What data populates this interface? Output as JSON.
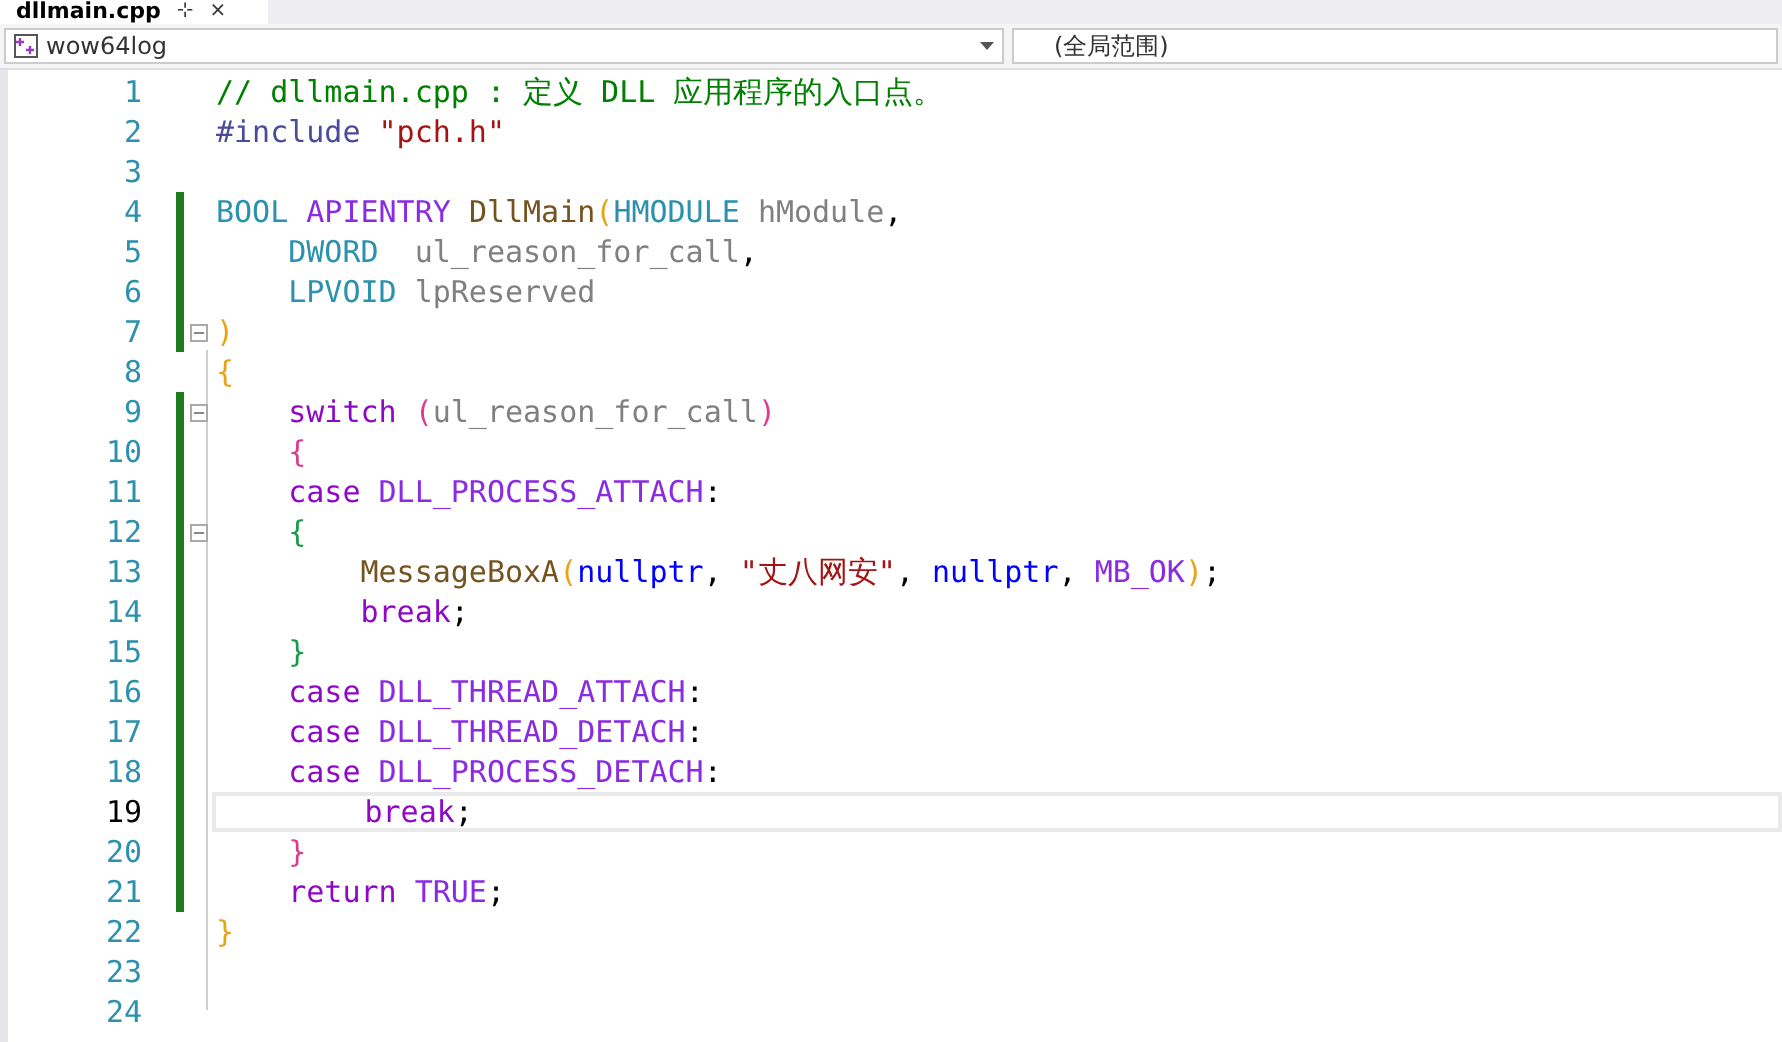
{
  "tab": {
    "title": "dllmain.cpp",
    "pin": "⊹",
    "close": "×"
  },
  "nav_bar": {
    "project": "wow64log",
    "scope": "(全局范围)"
  },
  "editor": {
    "lines": [
      {
        "number": "1",
        "current": false,
        "changed": false,
        "fold_box": false,
        "tokens": [
          {
            "kind": "comment",
            "text": "// dllmain.cpp : 定义 DLL 应用程序的入口点。"
          }
        ]
      },
      {
        "number": "2",
        "current": false,
        "changed": false,
        "fold_box": false,
        "tokens": [
          {
            "kind": "preproc",
            "text": "#include "
          },
          {
            "kind": "string",
            "text": "\"pch.h\""
          }
        ]
      },
      {
        "number": "3",
        "current": false,
        "changed": false,
        "fold_box": false
      },
      {
        "number": "4",
        "current": false,
        "changed": true,
        "fold_box": false,
        "tokens": [
          {
            "kind": "type",
            "text": "BOOL "
          },
          {
            "kind": "macro",
            "text": "APIENTRY "
          },
          {
            "kind": "func",
            "text": "DllMain"
          },
          {
            "kind": "brace1",
            "text": "("
          },
          {
            "kind": "type",
            "text": "HMODULE "
          },
          {
            "kind": "param",
            "text": "hModule"
          },
          {
            "kind": "plain",
            "text": ","
          }
        ]
      },
      {
        "number": "5",
        "current": false,
        "changed": true,
        "fold_box": false,
        "tokens": [
          {
            "kind": "type",
            "text": "    DWORD  "
          },
          {
            "kind": "param",
            "text": "ul_reason_for_call"
          },
          {
            "kind": "plain",
            "text": ","
          }
        ]
      },
      {
        "number": "6",
        "current": false,
        "changed": true,
        "fold_box": false,
        "tokens": [
          {
            "kind": "type",
            "text": "    LPVOID "
          },
          {
            "kind": "param",
            "text": "lpReserved"
          }
        ]
      },
      {
        "number": "7",
        "current": false,
        "changed": true,
        "fold_box": true,
        "tokens": [
          {
            "kind": "brace1",
            "text": ")"
          }
        ]
      },
      {
        "number": "8",
        "current": false,
        "changed": false,
        "fold_box": false,
        "tokens": [
          {
            "kind": "brace1",
            "text": "{"
          }
        ]
      },
      {
        "number": "9",
        "current": false,
        "changed": true,
        "fold_box": true,
        "tokens": [
          {
            "kind": "keyword",
            "text": "    switch "
          },
          {
            "kind": "brace2",
            "text": "("
          },
          {
            "kind": "param",
            "text": "ul_reason_for_call"
          },
          {
            "kind": "brace2",
            "text": ")"
          }
        ]
      },
      {
        "number": "10",
        "current": false,
        "changed": true,
        "fold_box": false,
        "tokens": [
          {
            "kind": "brace2",
            "text": "    {"
          }
        ]
      },
      {
        "number": "11",
        "current": false,
        "changed": true,
        "fold_box": false,
        "tokens": [
          {
            "kind": "keyword",
            "text": "    case "
          },
          {
            "kind": "macro",
            "text": "DLL_PROCESS_ATTACH"
          },
          {
            "kind": "plain",
            "text": ":"
          }
        ]
      },
      {
        "number": "12",
        "current": false,
        "changed": true,
        "fold_box": true,
        "tokens": [
          {
            "kind": "brace3",
            "text": "    {"
          }
        ]
      },
      {
        "number": "13",
        "current": false,
        "changed": true,
        "fold_box": false,
        "tokens": [
          {
            "kind": "func",
            "text": "        MessageBoxA"
          },
          {
            "kind": "brace1",
            "text": "("
          },
          {
            "kind": "constant",
            "text": "nullptr"
          },
          {
            "kind": "plain",
            "text": ", "
          },
          {
            "kind": "string",
            "text": "\"丈八网安\""
          },
          {
            "kind": "plain",
            "text": ", "
          },
          {
            "kind": "constant",
            "text": "nullptr"
          },
          {
            "kind": "plain",
            "text": ", "
          },
          {
            "kind": "macro",
            "text": "MB_OK"
          },
          {
            "kind": "brace1",
            "text": ")"
          },
          {
            "kind": "plain",
            "text": ";"
          }
        ]
      },
      {
        "number": "14",
        "current": false,
        "changed": true,
        "fold_box": false,
        "tokens": [
          {
            "kind": "keyword",
            "text": "        break"
          },
          {
            "kind": "plain",
            "text": ";"
          }
        ]
      },
      {
        "number": "15",
        "current": false,
        "changed": true,
        "fold_box": false,
        "tokens": [
          {
            "kind": "brace3",
            "text": "    }"
          }
        ]
      },
      {
        "number": "16",
        "current": false,
        "changed": true,
        "fold_box": false,
        "tokens": [
          {
            "kind": "keyword",
            "text": "    case "
          },
          {
            "kind": "macro",
            "text": "DLL_THREAD_ATTACH"
          },
          {
            "kind": "plain",
            "text": ":"
          }
        ]
      },
      {
        "number": "17",
        "current": false,
        "changed": true,
        "fold_box": false,
        "tokens": [
          {
            "kind": "keyword",
            "text": "    case "
          },
          {
            "kind": "macro",
            "text": "DLL_THREAD_DETACH"
          },
          {
            "kind": "plain",
            "text": ":"
          }
        ]
      },
      {
        "number": "18",
        "current": false,
        "changed": true,
        "fold_box": false,
        "tokens": [
          {
            "kind": "keyword",
            "text": "    case "
          },
          {
            "kind": "macro",
            "text": "DLL_PROCESS_DETACH"
          },
          {
            "kind": "plain",
            "text": ":"
          }
        ]
      },
      {
        "number": "19",
        "current": true,
        "changed": true,
        "fold_box": false,
        "tokens": [
          {
            "kind": "keyword",
            "text": "        break"
          },
          {
            "kind": "plain",
            "text": ";"
          }
        ]
      },
      {
        "number": "20",
        "current": false,
        "changed": true,
        "fold_box": false,
        "tokens": [
          {
            "kind": "brace2",
            "text": "    }"
          }
        ]
      },
      {
        "number": "21",
        "current": false,
        "changed": true,
        "fold_box": false,
        "tokens": [
          {
            "kind": "keyword",
            "text": "    return "
          },
          {
            "kind": "macro",
            "text": "TRUE"
          },
          {
            "kind": "plain",
            "text": ";"
          }
        ]
      },
      {
        "number": "22",
        "current": false,
        "changed": false,
        "fold_box": false,
        "tokens": [
          {
            "kind": "brace1",
            "text": "}"
          }
        ]
      },
      {
        "number": "23",
        "current": false,
        "changed": false,
        "fold_box": false
      },
      {
        "number": "24",
        "current": false,
        "changed": false,
        "fold_box": false
      }
    ]
  }
}
